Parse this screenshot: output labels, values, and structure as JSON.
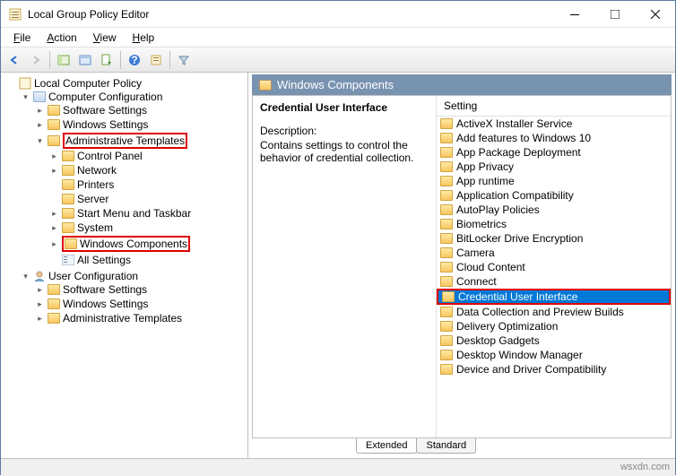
{
  "window": {
    "title": "Local Group Policy Editor"
  },
  "menu": {
    "file": "File",
    "action": "Action",
    "view": "View",
    "help": "Help"
  },
  "tree": {
    "root": "Local Computer Policy",
    "computer": "Computer Configuration",
    "software": "Software Settings",
    "windows": "Windows Settings",
    "admin": "Administrative Templates",
    "cp": "Control Panel",
    "net": "Network",
    "prn": "Printers",
    "srv": "Server",
    "start": "Start Menu and Taskbar",
    "sys": "System",
    "wcomp": "Windows Components",
    "allset": "All Settings",
    "user": "User Configuration",
    "u_soft": "Software Settings",
    "u_win": "Windows Settings",
    "u_admin": "Administrative Templates"
  },
  "header": {
    "title": "Windows Components"
  },
  "desc": {
    "title": "Credential User Interface",
    "label": "Description:",
    "text": "Contains settings to control the behavior of credential collection."
  },
  "list": {
    "header": "Setting",
    "items": [
      "ActiveX Installer Service",
      "Add features to Windows 10",
      "App Package Deployment",
      "App Privacy",
      "App runtime",
      "Application Compatibility",
      "AutoPlay Policies",
      "Biometrics",
      "BitLocker Drive Encryption",
      "Camera",
      "Cloud Content",
      "Connect",
      "Credential User Interface",
      "Data Collection and Preview Builds",
      "Delivery Optimization",
      "Desktop Gadgets",
      "Desktop Window Manager",
      "Device and Driver Compatibility"
    ],
    "selected_index": 12
  },
  "tabs": {
    "extended": "Extended",
    "standard": "Standard"
  },
  "watermark": "wsxdn.com"
}
